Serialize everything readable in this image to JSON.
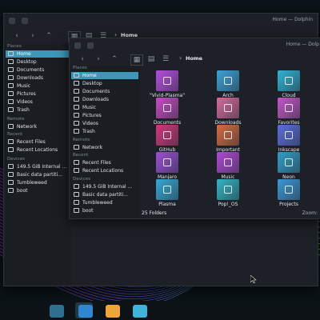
{
  "window_back": {
    "title": "Home — Dolphin",
    "breadcrumb": "Home",
    "places_label": "Places",
    "places": [
      "Home",
      "Desktop",
      "Documents",
      "Downloads",
      "Music",
      "Pictures",
      "Videos",
      "Trash"
    ],
    "remote_label": "Remote",
    "remote": [
      "Network"
    ],
    "recent_label": "Recent",
    "recent": [
      "Recent Files",
      "Recent Locations"
    ],
    "devices_label": "Devices",
    "devices": [
      "149.5 GiB Internal ...",
      "Basic data partiti...",
      "Tumbleweed",
      "boot"
    ]
  },
  "window_front": {
    "title": "Home — Dolp",
    "breadcrumb": "Home",
    "places_label": "Places",
    "places": [
      "Home",
      "Desktop",
      "Documents",
      "Downloads",
      "Music",
      "Pictures",
      "Videos",
      "Trash"
    ],
    "remote_label": "Remote",
    "remote": [
      "Network"
    ],
    "recent_label": "Recent",
    "recent": [
      "Recent Files",
      "Recent Locations"
    ],
    "devices_label": "Devices",
    "devices": [
      "149.5 GiB Internal ...",
      "Basic data partiti...",
      "Tumbleweed",
      "boot"
    ],
    "folders": [
      {
        "label": "\"Vivid-Plasma\"",
        "color": "#b64ddf"
      },
      {
        "label": "Arch",
        "color": "#3aa3d8"
      },
      {
        "label": "Cloud",
        "color": "#2fb3d6"
      },
      {
        "label": "Documents",
        "color": "#c94ac6"
      },
      {
        "label": "Downloads",
        "color": "#d96a9c"
      },
      {
        "label": "Favorites",
        "color": "#c556c7"
      },
      {
        "label": "GitHub",
        "color": "#d5357c"
      },
      {
        "label": "Important",
        "color": "#d86b3c"
      },
      {
        "label": "Inkscape",
        "color": "#5a6ee0"
      },
      {
        "label": "Manjaro",
        "color": "#9b4fd9"
      },
      {
        "label": "Music",
        "color": "#b248d6"
      },
      {
        "label": "Neon",
        "color": "#2f9fc8"
      },
      {
        "label": "Plasma",
        "color": "#35a9d8"
      },
      {
        "label": "Pop!_OS",
        "color": "#2fb6c2"
      },
      {
        "label": "Projects",
        "color": "#3a98d8"
      }
    ],
    "status_count": "25 Folders",
    "status_zoom": "Zoom:"
  },
  "taskbar": {
    "apps": [
      {
        "icon": "launcher-icon",
        "color": "#2f6f8f"
      },
      {
        "icon": "system-settings-icon",
        "color": "#2f86d1"
      },
      {
        "icon": "discover-icon",
        "color": "#f0a53a"
      },
      {
        "icon": "dolphin-icon",
        "color": "#3fb3d9"
      }
    ]
  }
}
